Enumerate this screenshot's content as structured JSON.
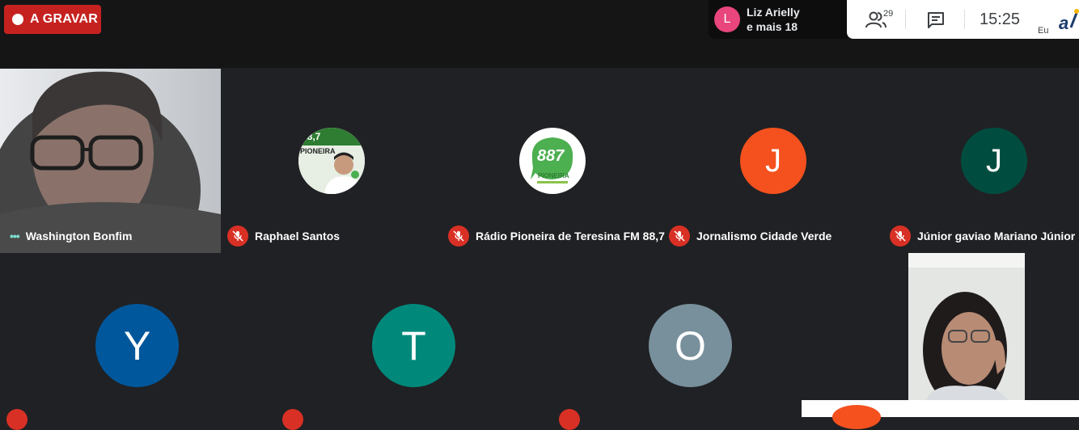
{
  "recording": {
    "label": "A GRAVAR"
  },
  "notification": {
    "avatar_letter": "L",
    "line1": "Liz Arielly",
    "line2": "e mais 18"
  },
  "controls": {
    "people_count": "29",
    "time": "15:25",
    "self_label": "Eu"
  },
  "participants": [
    {
      "name": "Washington Bonfim",
      "type": "video"
    },
    {
      "name": "Raphael Santos",
      "type": "photo"
    },
    {
      "name": "Rádio Pioneira de Teresina FM 88,7",
      "type": "logo",
      "logo_number": "887",
      "logo_text": "PIONEIRA"
    },
    {
      "name": "Jornalismo Cidade Verde",
      "type": "initial",
      "initial": "J",
      "color": "#f4511e"
    },
    {
      "name": "Júnior gaviao Mariano Júnior",
      "type": "initial",
      "initial": "J",
      "color": "#004d40"
    },
    {
      "name": "",
      "type": "initial",
      "initial": "Y",
      "color": "#01579b"
    },
    {
      "name": "",
      "type": "initial",
      "initial": "T",
      "color": "#00897b"
    },
    {
      "name": "",
      "type": "initial",
      "initial": "O",
      "color": "#78909c"
    },
    {
      "name": "",
      "type": "video"
    }
  ],
  "colors": {
    "background": "#202124",
    "topbar": "#151516",
    "record": "#c5221f",
    "muted": "#d93025"
  }
}
